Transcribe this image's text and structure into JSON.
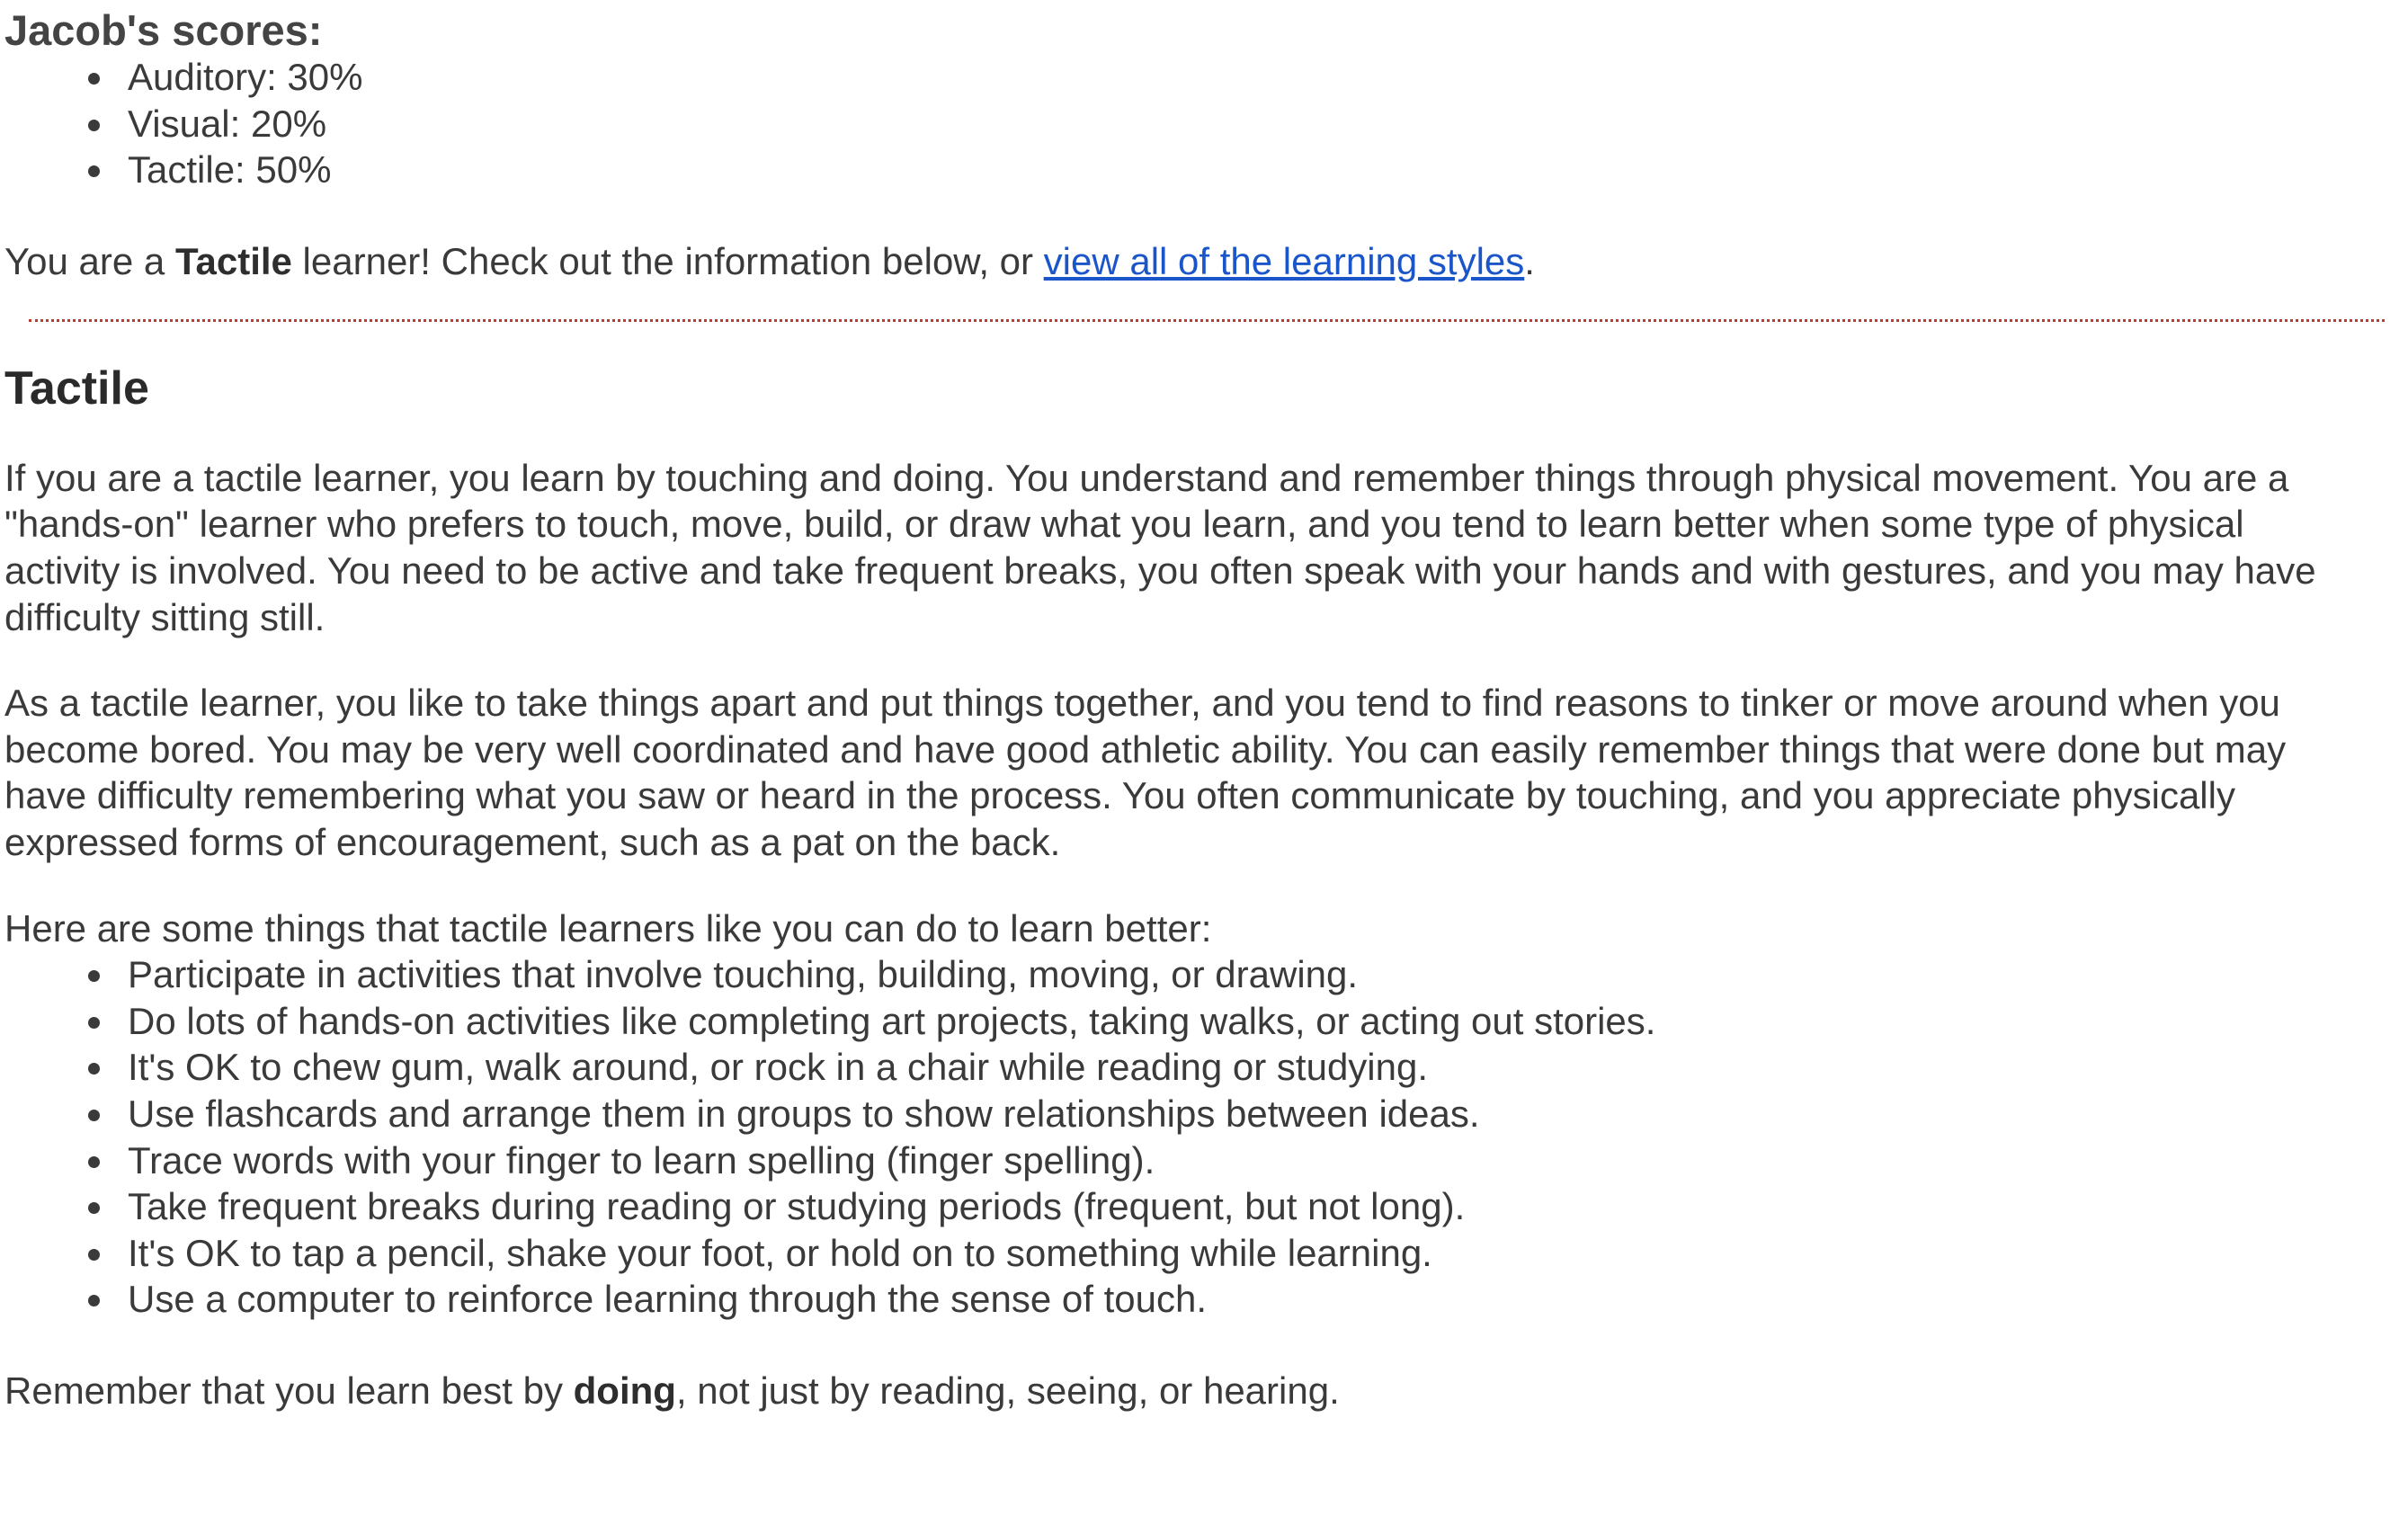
{
  "scores": {
    "title": "Jacob's scores:",
    "items": [
      "Auditory: 30%",
      "Visual: 20%",
      "Tactile: 50%"
    ]
  },
  "result": {
    "prefix": "You are a ",
    "style": "Tactile",
    "middle": " learner! Check out the information below, or ",
    "link_text": "view all of the learning styles",
    "suffix": "."
  },
  "section": {
    "title": "Tactile",
    "paragraphs": [
      "If you are a tactile learner, you learn by touching and doing. You understand and remember things through physical movement. You are a \"hands-on\" learner who prefers to touch, move, build, or draw what you learn, and you tend to learn better when some type of physical activity is involved. You need to be active and take frequent breaks, you often speak with your hands and with gestures, and you may have difficulty sitting still.",
      "As a tactile learner, you like to take things apart and put things together, and you tend to find reasons to tinker or move around when you become bored. You may be very well coordinated and have good athletic ability. You can easily remember things that were done but may have difficulty remembering what you saw or heard in the process. You often communicate by touching, and you appreciate physically expressed forms of encouragement, such as a pat on the back.",
      "Here are some things that tactile learners like you can do to learn better:"
    ],
    "tips": [
      "Participate in activities that involve touching, building, moving, or drawing.",
      "Do lots of hands-on activities like completing art projects, taking walks, or acting out stories.",
      "It's OK to chew gum, walk around, or rock in a chair while reading or studying.",
      "Use flashcards and arrange them in groups to show relationships between ideas.",
      "Trace words with your finger to learn spelling (finger spelling).",
      "Take frequent breaks during reading or studying periods (frequent, but not long).",
      "It's OK to tap a pencil, shake your foot, or hold on to something while learning.",
      "Use a computer to reinforce learning through the sense of touch."
    ],
    "closing": {
      "prefix": "Remember that you learn best by ",
      "emphasis": "doing",
      "suffix": ", not just by reading, seeing, or hearing."
    }
  },
  "colors": {
    "text": "#3a3a3a",
    "link": "#1a56c9",
    "divider": "#c0392b"
  }
}
